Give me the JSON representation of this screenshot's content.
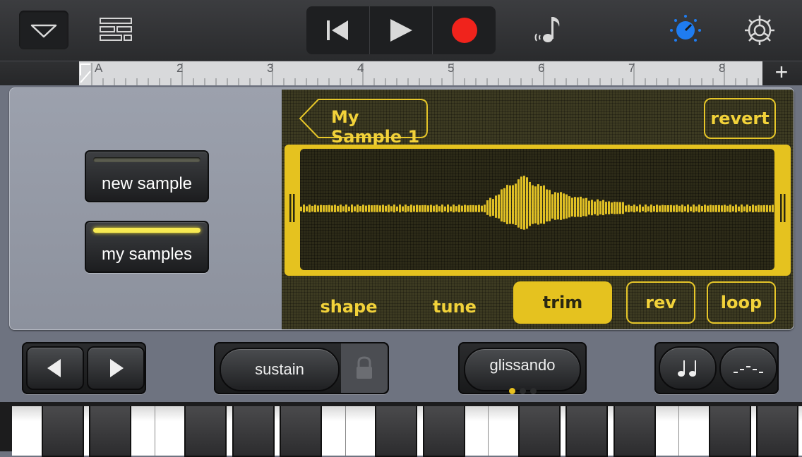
{
  "toolbar": {
    "menu_icon": "triangle-down-icon",
    "tracks_icon": "tracks-view-icon",
    "transport": [
      "skip-back-icon",
      "play-icon",
      "record-icon"
    ],
    "record_color": "#f0231c",
    "note_icon": "music-note-icon",
    "knob_icon": "smart-controls-knob-icon",
    "knob_color": "#1f7cf0",
    "settings_icon": "gear-icon"
  },
  "ruler": {
    "labels": [
      "A",
      "2",
      "3",
      "4",
      "5",
      "6",
      "7",
      "8"
    ],
    "add_icon": "plus-icon"
  },
  "sampler": {
    "new_sample_label": "new sample",
    "my_samples_label": "my samples",
    "sample_name": "My Sample 1",
    "revert_label": "revert",
    "tabs": [
      "shape",
      "tune",
      "trim"
    ],
    "active_tab": "trim",
    "rev_label": "rev",
    "loop_label": "loop",
    "accent_color": "#e5c21f"
  },
  "controls": {
    "prev_icon": "chevron-left-icon",
    "next_icon": "chevron-right-icon",
    "sustain_label": "sustain",
    "lock_icon": "lock-icon",
    "glissando_label": "glissando",
    "glissando_mode_index": 0,
    "glissando_mode_count": 3,
    "notes_icon": "eighth-notes-icon",
    "arpeggio_icon": "arpeggio-icon"
  }
}
